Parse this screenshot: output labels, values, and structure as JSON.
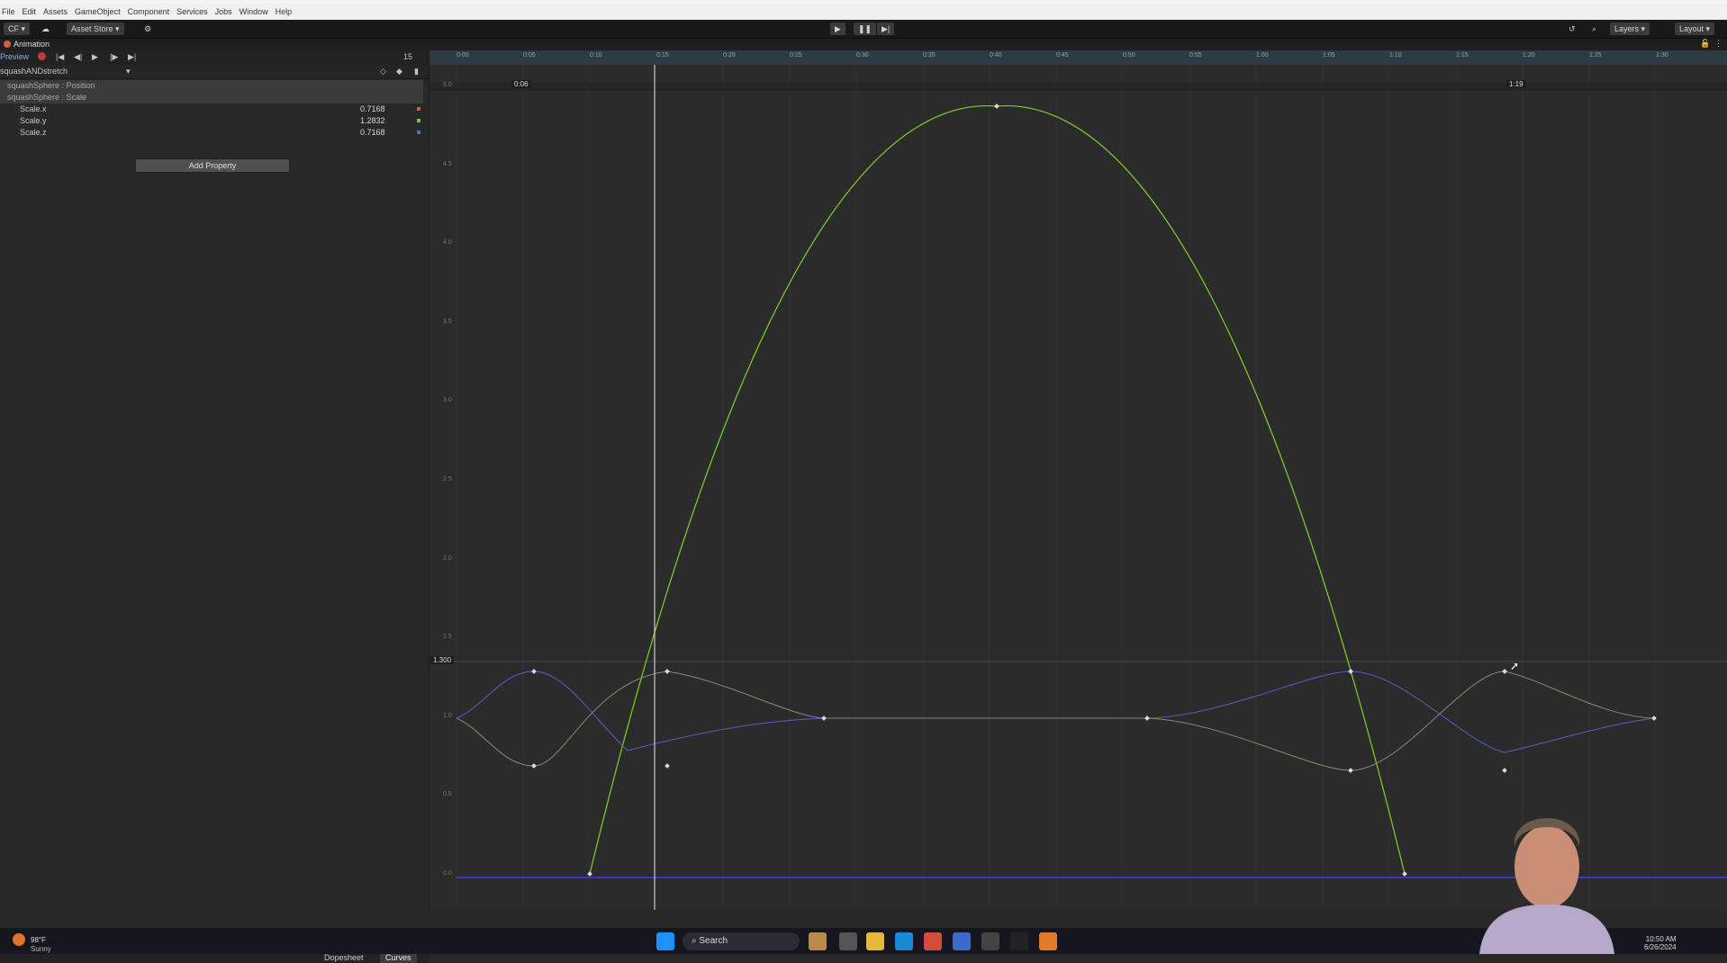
{
  "menubar": {
    "items": [
      "File",
      "Edit",
      "Assets",
      "GameObject",
      "Component",
      "Services",
      "Jobs",
      "Window",
      "Help"
    ]
  },
  "toolbar": {
    "account": "CF ▾",
    "asset_store": "Asset Store ▾",
    "layers": "Layers",
    "layout": "Layout",
    "play_icon": "play-icon",
    "pause_icon": "pause-icon",
    "step_icon": "step-icon"
  },
  "animation": {
    "window_title": "Animation",
    "preview_label": "Preview",
    "frame_field": "15",
    "clip_name": "squashANDstretch",
    "properties": [
      {
        "label": "squashSphere : Position",
        "value": "",
        "group": true
      },
      {
        "label": "squashSphere : Scale",
        "value": "",
        "group": true
      },
      {
        "label": "Scale.x",
        "value": "0.7168",
        "group": false,
        "color": "#d05a5a"
      },
      {
        "label": "Scale.y",
        "value": "1.2832",
        "group": false,
        "color": "#7ac04a"
      },
      {
        "label": "Scale.z",
        "value": "0.7168",
        "group": false,
        "color": "#5a6ad0"
      }
    ],
    "add_property": "Add Property",
    "tabs": {
      "dopesheet": "Dopesheet",
      "curves": "Curves"
    },
    "ruler_labels": [
      "0:00",
      "0:05",
      "0:10",
      "0:15",
      "0:20",
      "0:25",
      "0:30",
      "0:35",
      "0:40",
      "0:45",
      "0:50",
      "0:55",
      "1:00",
      "1:05",
      "1:10",
      "1:15",
      "1:20",
      "1:25",
      "1:30"
    ],
    "range_start": "0:06",
    "range_end": "1:19",
    "value_marker": "1.300",
    "y_axis_labels": [
      "5.0",
      "4.5",
      "4.0",
      "3.5",
      "3.0",
      "2.5",
      "2.0",
      "1.5",
      "1.0",
      "0.5",
      "0.0"
    ]
  },
  "taskbar": {
    "weather_temp": "98°F",
    "weather_desc": "Sunny",
    "search": "Search",
    "time": "10:50 AM",
    "date": "6/26/2024"
  }
}
